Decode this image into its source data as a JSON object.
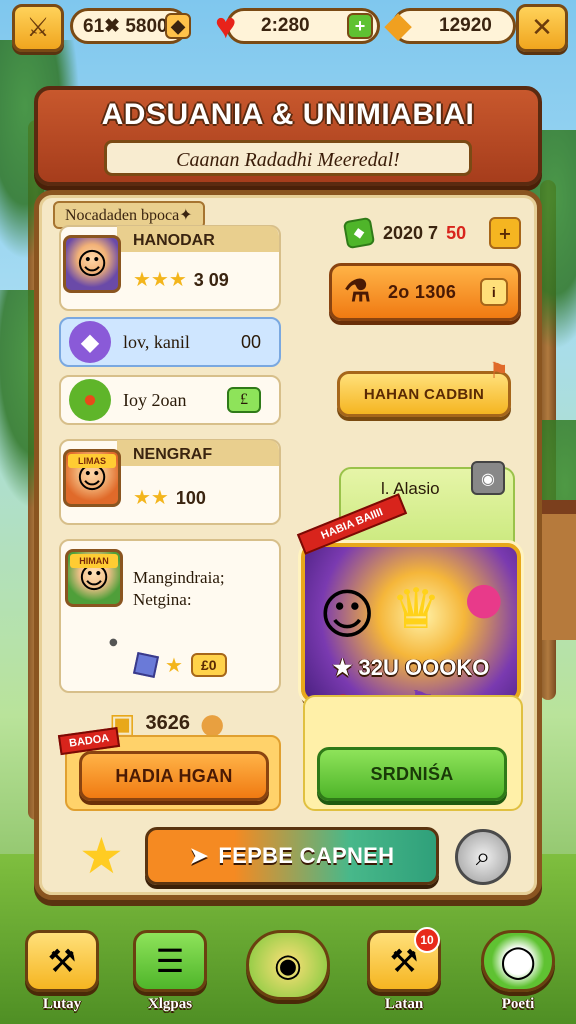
{
  "topbar": {
    "menu_icon": "sword-icon",
    "coins": "61✖ 5800",
    "hearts": "2:280",
    "gems": "12920",
    "close_icon": "close-icon"
  },
  "banner": {
    "title": "ADSUANIA & UNIMIABIAI",
    "subtitle": "Caanan Radadhi Meeredal!"
  },
  "panel": {
    "header": "Nocadaden bpoca✦",
    "top_right": {
      "value": "2020 7",
      "red": "50"
    },
    "cards": [
      {
        "name": "HANODAR",
        "stars": "★★★",
        "score": "3 09"
      },
      {
        "name": "NENGRAF",
        "stars": "★★",
        "score": "100",
        "tag": "LIMAS"
      },
      {
        "name": "Mangindraia; Netgina:",
        "tag": "HIMAN"
      }
    ],
    "rows": [
      {
        "text": "lov, kanil",
        "value": "00"
      },
      {
        "text": "Ioy 2oan",
        "value": "£"
      }
    ],
    "card3_icons": "★",
    "card3_value": "£0",
    "price_orange": "2o 1306",
    "btn_yellow": "HAHAN CADBIN",
    "aliasio_label": "l. Alasio",
    "ribbon": "HABIA BAIIII",
    "reward_value": "★ 32U OOOKO",
    "bottom_cost": "3626",
    "bottom_left_tag": "BADOA",
    "btn_left": "HADIA HGAN",
    "btn_right": "SRDNIŚA",
    "main_button": "FEPBE CAPNEH"
  },
  "nav": {
    "items": [
      {
        "label": "Lutay",
        "icon": "axe-icon"
      },
      {
        "label": "Xlgpas",
        "icon": "list-icon"
      },
      {
        "label": "",
        "icon": "home-icon"
      },
      {
        "label": "Latan",
        "icon": "hammer-icon",
        "badge": "10"
      },
      {
        "label": "Poeti",
        "icon": "search-icon"
      }
    ]
  }
}
